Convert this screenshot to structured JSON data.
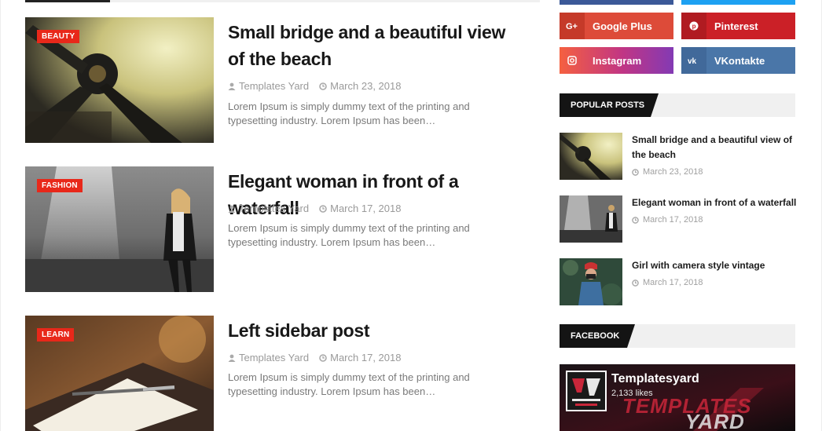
{
  "posts": [
    {
      "category": "BEAUTY",
      "title": "Small bridge and a beautiful view of the beach",
      "author": "Templates Yard",
      "date": "March 23, 2018",
      "excerpt": "Lorem Ipsum is simply dummy text of the printing and typesetting industry. Lorem Ipsum has been…"
    },
    {
      "category": "FASHION",
      "title": "Elegant woman in front of a waterfall",
      "author": "Templates Yard",
      "date": "March 17, 2018",
      "excerpt": "Lorem Ipsum is simply dummy text of the printing and typesetting industry. Lorem Ipsum has been…"
    },
    {
      "category": "LEARN",
      "title": "Left sidebar post",
      "author": "Templates Yard",
      "date": "March 17, 2018",
      "excerpt": "Lorem Ipsum is simply dummy text of the printing and typesetting industry. Lorem Ipsum has been…"
    }
  ],
  "social": [
    {
      "label": "Google Plus",
      "icon": "google-plus-icon",
      "color": "#dd4b39"
    },
    {
      "label": "Pinterest",
      "icon": "pinterest-icon",
      "color": "#cb2027"
    },
    {
      "label": "Instagram",
      "icon": "instagram-icon",
      "color": "#c13584"
    },
    {
      "label": "VKontakte",
      "icon": "vk-icon",
      "color": "#4a76a8"
    }
  ],
  "popular": {
    "heading": "POPULAR POSTS",
    "items": [
      {
        "title": "Small bridge and a beautiful view of the beach",
        "date": "March 23, 2018"
      },
      {
        "title": "Elegant woman in front of a waterfall",
        "date": "March 17, 2018"
      },
      {
        "title": "Girl with camera style vintage",
        "date": "March 17, 2018"
      }
    ]
  },
  "facebook": {
    "heading": "FACEBOOK",
    "page_name": "Templatesyard",
    "likes": "2,133 likes",
    "banner_text_1": "TEMPLATES",
    "banner_text_2": "YARD"
  },
  "colors": {
    "accent": "#e8281a",
    "dark": "#141414"
  }
}
